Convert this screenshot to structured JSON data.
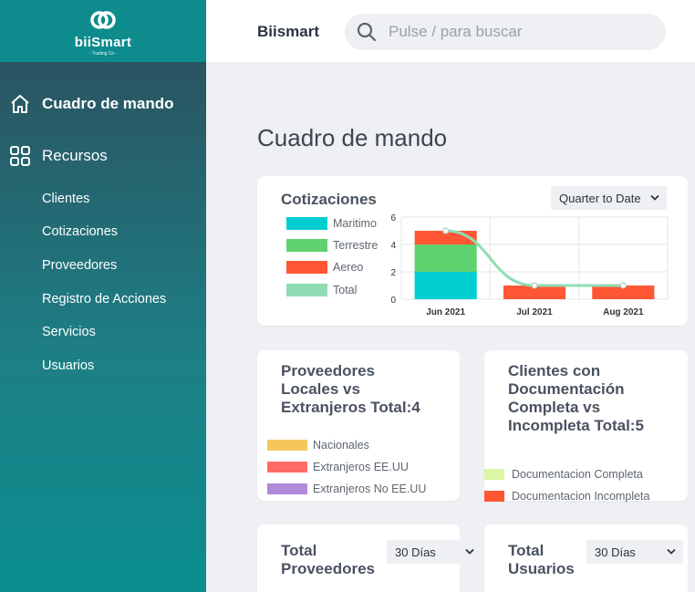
{
  "brand": {
    "name": "biiSmart",
    "tagline": "- Trading Co -"
  },
  "header": {
    "app_name": "Biismart",
    "search_placeholder": "Pulse / para buscar"
  },
  "sidebar": {
    "dashboard_label": "Cuadro de mando",
    "resources_label": "Recursos",
    "items": [
      {
        "label": "Clientes"
      },
      {
        "label": "Cotizaciones"
      },
      {
        "label": "Proveedores"
      },
      {
        "label": "Registro de Acciones"
      },
      {
        "label": "Servicios"
      },
      {
        "label": "Usuarios"
      }
    ]
  },
  "page": {
    "title": "Cuadro de mando"
  },
  "cotizaciones": {
    "title": "Cotizaciones",
    "period": "Quarter to Date",
    "legend": [
      {
        "label": "Maritimo",
        "color": "#00ced1"
      },
      {
        "label": "Terrestre",
        "color": "#5fd16f"
      },
      {
        "label": "Aereo",
        "color": "#ff5733"
      },
      {
        "label": "Total",
        "color": "#8fdcb4"
      }
    ]
  },
  "chart_data": {
    "type": "bar",
    "categories": [
      "Jun 2021",
      "Jul 2021",
      "Aug 2021"
    ],
    "series": [
      {
        "name": "Maritimo",
        "values": [
          2,
          0,
          0
        ],
        "color": "#00ced1"
      },
      {
        "name": "Terrestre",
        "values": [
          2,
          0,
          0
        ],
        "color": "#5fd16f"
      },
      {
        "name": "Aereo",
        "values": [
          1,
          1,
          1
        ],
        "color": "#ff5733"
      },
      {
        "name": "Total",
        "type": "line",
        "values": [
          5,
          1,
          1
        ],
        "color": "#8fdcb4"
      }
    ],
    "yticks": [
      "0",
      "2",
      "4",
      "6"
    ],
    "ylim": [
      0,
      6
    ],
    "stacked": true,
    "grid": true
  },
  "proveedores_card": {
    "title_lines": [
      "Proveedores",
      "Locales vs",
      "Extranjeros Total:4"
    ],
    "legend": [
      {
        "label": "Nacionales",
        "color": "#f7c65a"
      },
      {
        "label": "Extranjeros EE.UU",
        "color": "#ff6b66"
      },
      {
        "label": "Extranjeros No EE.UU",
        "color": "#b08ad8"
      }
    ]
  },
  "clientes_card": {
    "title_lines": [
      "Clientes con",
      "Documentación",
      "Completa vs",
      "Incompleta Total:5"
    ],
    "legend": [
      {
        "label": "Documentacion Completa",
        "color": "#def7a4"
      },
      {
        "label": "Documentacion Incompleta",
        "color": "#ff5733"
      }
    ]
  },
  "total_proveedores": {
    "title_lines": [
      "Total",
      "Proveedores"
    ],
    "period": "30 Días"
  },
  "total_usuarios": {
    "title_lines": [
      "Total",
      "Usuarios"
    ],
    "period": "30 Días"
  }
}
